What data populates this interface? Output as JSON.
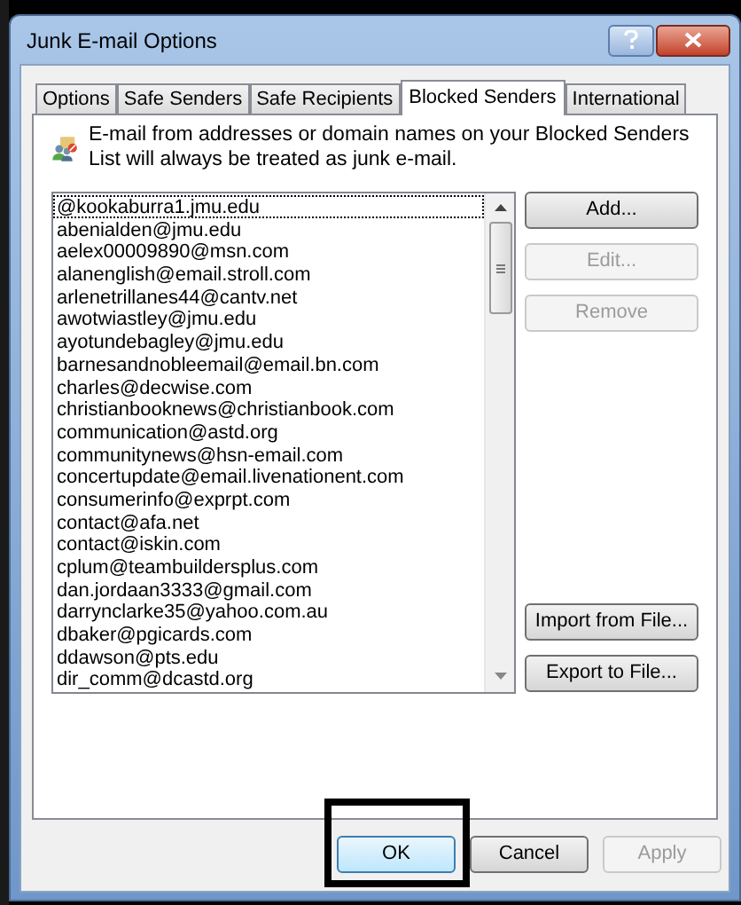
{
  "window": {
    "title": "Junk E-mail Options"
  },
  "tabs": [
    {
      "label": "Options",
      "selected": false
    },
    {
      "label": "Safe Senders",
      "selected": false
    },
    {
      "label": "Safe Recipients",
      "selected": false
    },
    {
      "label": "Blocked Senders",
      "selected": true
    },
    {
      "label": "International",
      "selected": false
    }
  ],
  "description": "E-mail from addresses or domain names on your Blocked Senders List will always be treated as junk e-mail.",
  "list": [
    {
      "text": "@kookaburra1.jmu.edu",
      "selected": true
    },
    {
      "text": "abenialden@jmu.edu",
      "selected": false
    },
    {
      "text": "aelex00009890@msn.com",
      "selected": false
    },
    {
      "text": "alanenglish@email.stroll.com",
      "selected": false
    },
    {
      "text": "arlenetrillanes44@cantv.net",
      "selected": false
    },
    {
      "text": "awotwiastley@jmu.edu",
      "selected": false
    },
    {
      "text": "ayotundebagley@jmu.edu",
      "selected": false
    },
    {
      "text": "barnesandnobleemail@email.bn.com",
      "selected": false
    },
    {
      "text": "charles@decwise.com",
      "selected": false
    },
    {
      "text": "christianbooknews@christianbook.com",
      "selected": false
    },
    {
      "text": "communication@astd.org",
      "selected": false
    },
    {
      "text": "communitynews@hsn-email.com",
      "selected": false
    },
    {
      "text": "concertupdate@email.livenationent.com",
      "selected": false
    },
    {
      "text": "consumerinfo@exprpt.com",
      "selected": false
    },
    {
      "text": "contact@afa.net",
      "selected": false
    },
    {
      "text": "contact@iskin.com",
      "selected": false
    },
    {
      "text": "cplum@teambuildersplus.com",
      "selected": false
    },
    {
      "text": "dan.jordaan3333@gmail.com",
      "selected": false
    },
    {
      "text": "darrynclarke35@yahoo.com.au",
      "selected": false
    },
    {
      "text": "dbaker@pgicards.com",
      "selected": false
    },
    {
      "text": "ddawson@pts.edu",
      "selected": false
    },
    {
      "text": "dir_comm@dcastd.org",
      "selected": false
    }
  ],
  "side_buttons": [
    {
      "label": "Add...",
      "disabled": false
    },
    {
      "label": "Edit...",
      "disabled": true
    },
    {
      "label": "Remove",
      "disabled": true
    }
  ],
  "file_buttons": [
    {
      "label": "Import from File...",
      "disabled": false
    },
    {
      "label": "Export to File...",
      "disabled": false
    }
  ],
  "footer_buttons": [
    {
      "label": "OK",
      "disabled": false,
      "default": true,
      "highlighted": true
    },
    {
      "label": "Cancel",
      "disabled": false,
      "default": false,
      "highlighted": false
    },
    {
      "label": "Apply",
      "disabled": true,
      "default": false,
      "highlighted": false
    }
  ]
}
